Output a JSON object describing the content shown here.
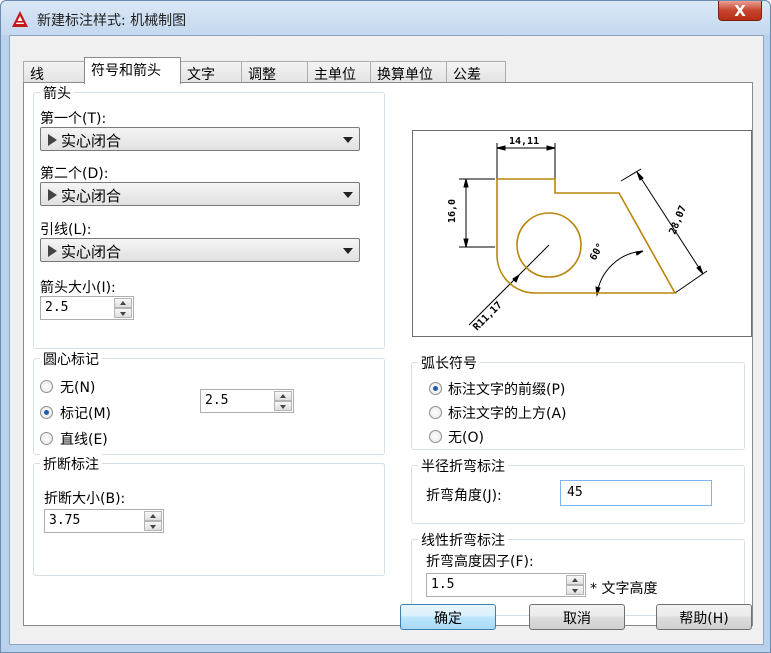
{
  "window": {
    "title": "新建标注样式: 机械制图",
    "close_label": "X"
  },
  "tabs": [
    {
      "label": "线"
    },
    {
      "label": "符号和箭头"
    },
    {
      "label": "文字"
    },
    {
      "label": "调整"
    },
    {
      "label": "主单位"
    },
    {
      "label": "换算单位"
    },
    {
      "label": "公差"
    }
  ],
  "arrows": {
    "title": "箭头",
    "first_label": "第一个(T):",
    "first_value": "实心闭合",
    "second_label": "第二个(D):",
    "second_value": "实心闭合",
    "leader_label": "引线(L):",
    "leader_value": "实心闭合",
    "size_label": "箭头大小(I):",
    "size_value": "2.5"
  },
  "center_mark": {
    "title": "圆心标记",
    "none_label": "无(N)",
    "mark_label": "标记(M)",
    "line_label": "直线(E)",
    "selected": "mark",
    "size_value": "2.5"
  },
  "break": {
    "title": "折断标注",
    "size_label": "折断大小(B):",
    "size_value": "3.75"
  },
  "arc_length": {
    "title": "弧长符号",
    "prefix_label": "标注文字的前缀(P)",
    "above_label": "标注文字的上方(A)",
    "none_label": "无(O)",
    "selected": "prefix"
  },
  "radius_jog": {
    "title": "半径折弯标注",
    "angle_label": "折弯角度(J):",
    "angle_value": "45"
  },
  "linear_jog": {
    "title": "线性折弯标注",
    "factor_label": "折弯高度因子(F):",
    "factor_value": "1.5",
    "suffix": "* 文字高度"
  },
  "preview": {
    "dim_top": "14,11",
    "dim_left": "16,0",
    "dim_slant": "28,07",
    "dim_angle": "60°",
    "dim_radius": "R11,17",
    "outline_color": "#b8860b"
  },
  "buttons": {
    "ok": "确定",
    "cancel": "取消",
    "help": "帮助(H)"
  }
}
